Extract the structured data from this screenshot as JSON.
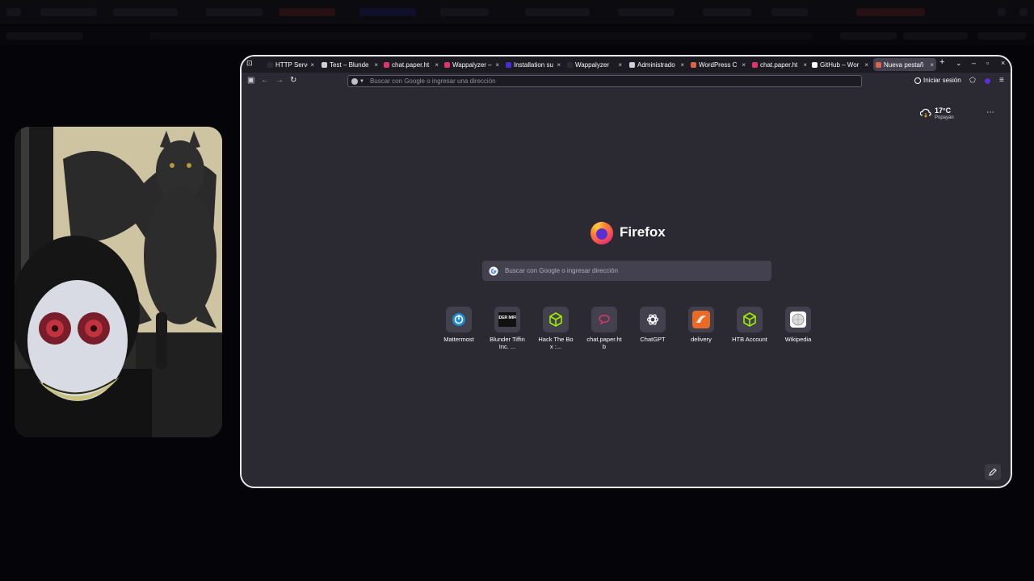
{
  "browser": {
    "tabs": [
      {
        "title": "HTTP Server",
        "favicon_color": "#2b2a33",
        "close": "×"
      },
      {
        "title": "Test – Blunde",
        "favicon_color": "#cfcfd8",
        "close": "×"
      },
      {
        "title": "chat.paper.ht",
        "favicon_color": "#e0356b",
        "close": "×"
      },
      {
        "title": "Wappalyzer –",
        "favicon_color": "#e0356b",
        "close": "×"
      },
      {
        "title": "Installation su",
        "favicon_color": "#4a2bd6",
        "close": "×"
      },
      {
        "title": "Wappalyzer",
        "favicon_color": "#2b2a33",
        "close": "×"
      },
      {
        "title": "Administrado",
        "favicon_color": "#cfcfd8",
        "close": "×"
      },
      {
        "title": "WordPress C",
        "favicon_color": "#e0624b",
        "close": "×"
      },
      {
        "title": "chat.paper.ht",
        "favicon_color": "#e0356b",
        "close": "×"
      },
      {
        "title": "GitHub – Wor",
        "favicon_color": "#fbfbfe",
        "close": "×"
      },
      {
        "title": "Nueva pestañ",
        "favicon_color": "#e0624b",
        "close": "×",
        "active": true
      }
    ],
    "new_tab_button": "+",
    "tab_list_button": "⌄",
    "minimize": "–",
    "maximize": "▫",
    "close_window": "×",
    "address_bar": {
      "placeholder": "Buscar con Google o ingresar una dirección"
    },
    "sign_in_label": "Iniciar sesión",
    "menu_icon": "≡"
  },
  "newtab": {
    "weather": {
      "temp": "17°C",
      "location": "Popayán"
    },
    "brand": "Firefox",
    "search_placeholder": "Buscar con Google o ingresar dirección",
    "shortcuts": [
      {
        "label": "Mattermost",
        "icon": "mattermost-icon",
        "color": "#1e8dd6"
      },
      {
        "label": "Blunder Tiffin Inc. ...",
        "icon": "dunder-mifflin-icon",
        "color": "#111111"
      },
      {
        "label": "Hack The Box :...",
        "icon": "htb-cube-icon",
        "color": "#9fef00"
      },
      {
        "label": "chat.paper.htb",
        "icon": "chat-bubble-icon",
        "color": "#e0356b"
      },
      {
        "label": "ChatGPT",
        "icon": "chatgpt-icon",
        "color": "#fbfbfe"
      },
      {
        "label": "delivery",
        "icon": "delivery-icon",
        "color": "#e86a24"
      },
      {
        "label": "HTB Account",
        "icon": "htb-cube-icon",
        "color": "#9fef00"
      },
      {
        "label": "Wikipedia",
        "icon": "wikipedia-globe-icon",
        "color": "#dcdcdc"
      }
    ],
    "dunder_logo_text": "DUNDER MIFFLIN",
    "more_dots": "⋯"
  }
}
